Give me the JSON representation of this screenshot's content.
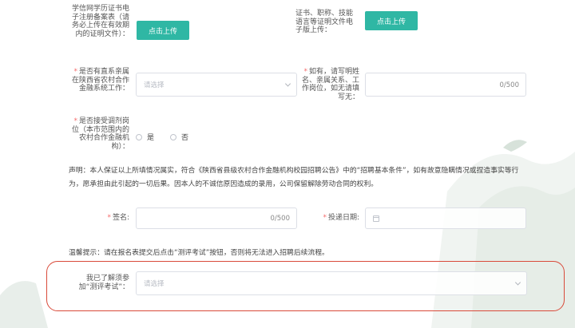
{
  "form": {
    "diploma_label": "学信网学历证书电子注册备案表（请务必上传在有效期内的证明文件）：",
    "diploma_button": "点击上传",
    "cert_label": "证书、职称、技能语言等证明文件电子版上传：",
    "cert_button": "点击上传",
    "relative_label": "是否有直系亲属在陕西省农村合作金融系统工作：",
    "relative_placeholder": "请选择",
    "relative_detail_label": "如有，请写明姓名、亲属关系、工作岗位，如无请填写无：",
    "relative_detail_counter": "0/500",
    "adjust_label": "是否接受调剂岗位（本市范围内的农村合作金融机构）：",
    "adjust_options": [
      "是",
      "否"
    ],
    "declaration": "声明：本人保证以上所填情况属实，符合《陕西省县级农村合作金融机构校园招聘公告》中的“招聘基本条件”，如有故意隐瞒情况或捏造事实等行为，愿承担由此引起的一切后果。因本人的不诚信原因造成的录用，公司保留解除劳动合同的权利。",
    "signature_label": "签名:",
    "signature_counter": "0/500",
    "submit_date_label": "投递日期:",
    "tip": "温馨提示：请在报名表提交后点击“测评考试”按钮，否则将无法进入招聘后续流程。",
    "exam_label": "我已了解须参加“测评考试”：",
    "exam_placeholder": "请选择"
  },
  "colors": {
    "accent": "#2fb7a4",
    "required": "#f56c6c",
    "highlight": "#d94a3a"
  }
}
